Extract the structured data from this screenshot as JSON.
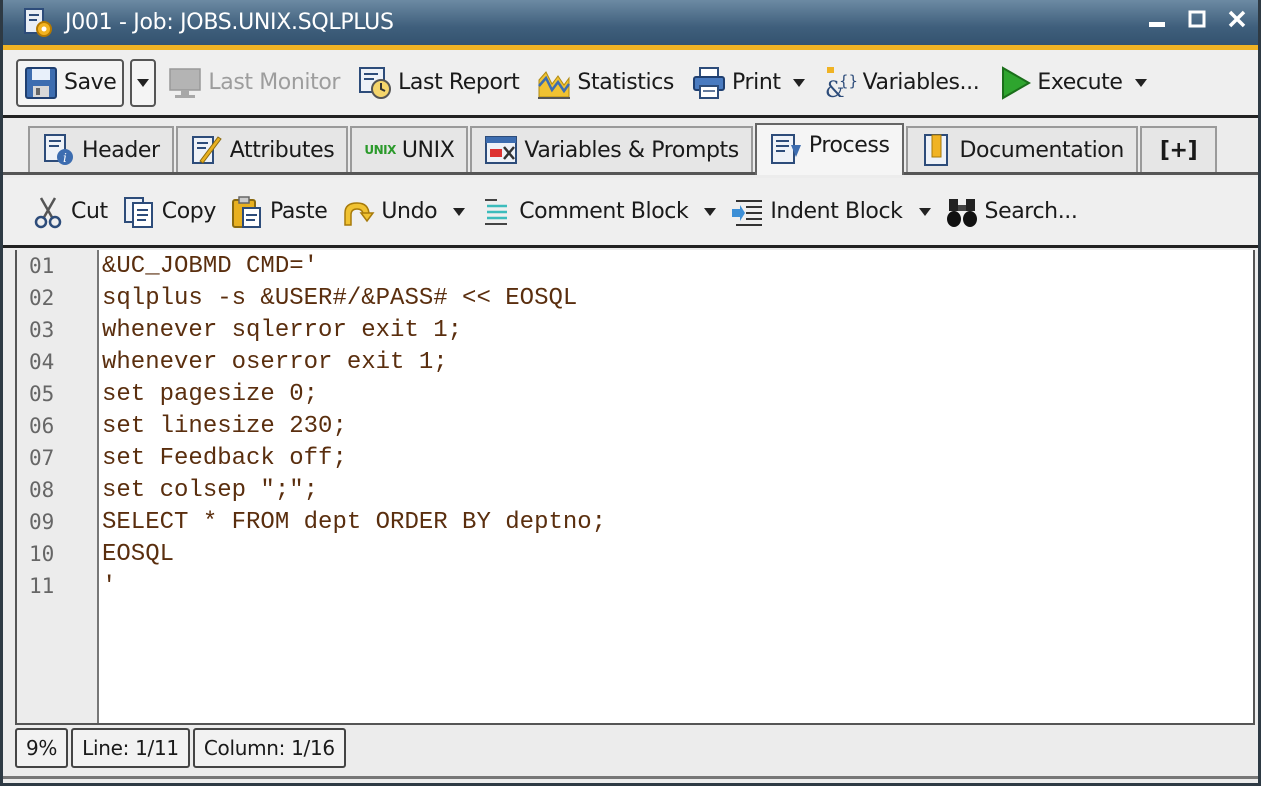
{
  "window": {
    "title": "J001 - Job: JOBS.UNIX.SQLPLUS",
    "controls": [
      "minimize",
      "maximize",
      "close"
    ],
    "accent_color": "#f0b324",
    "titlebar_color": "#3f5f7c"
  },
  "toolbar": {
    "save_label": "Save",
    "last_monitor_label": "Last Monitor",
    "last_report_label": "Last Report",
    "statistics_label": "Statistics",
    "print_label": "Print",
    "variables_label": "Variables...",
    "execute_label": "Execute"
  },
  "tabs": [
    {
      "label": "Header",
      "icon": "header-info-icon",
      "active": false
    },
    {
      "label": "Attributes",
      "icon": "attributes-pencil-icon",
      "active": false
    },
    {
      "label": "UNIX",
      "icon_text": "UNIX",
      "active": false
    },
    {
      "label": "Variables & Prompts",
      "icon": "variables-prompts-icon",
      "active": false
    },
    {
      "label": "Process",
      "icon": "process-icon",
      "active": true
    },
    {
      "label": "Documentation",
      "icon": "documentation-icon",
      "active": false
    },
    {
      "label": "[+]",
      "icon": "add-tab-icon",
      "active": false
    }
  ],
  "editor_toolbar": {
    "cut_label": "Cut",
    "copy_label": "Copy",
    "paste_label": "Paste",
    "undo_label": "Undo",
    "comment_block_label": "Comment Block",
    "indent_block_label": "Indent Block",
    "search_label": "Search..."
  },
  "editor": {
    "line_numbers": [
      "01",
      "02",
      "03",
      "04",
      "05",
      "06",
      "07",
      "08",
      "09",
      "10",
      "11"
    ],
    "lines": [
      "&UC_JOBMD CMD='",
      "sqlplus -s &USER#/&PASS# << EOSQL",
      "whenever sqlerror exit 1;",
      "whenever oserror exit 1;",
      "set pagesize 0;",
      "set linesize 230;",
      "set Feedback off;",
      "set colsep \";\";",
      "SELECT * FROM dept ORDER BY deptno;",
      "EOSQL",
      "'"
    ],
    "code_color": "#5a2e0e"
  },
  "status": {
    "percent": "9%",
    "line": "Line: 1/11",
    "column": "Column: 1/16"
  }
}
